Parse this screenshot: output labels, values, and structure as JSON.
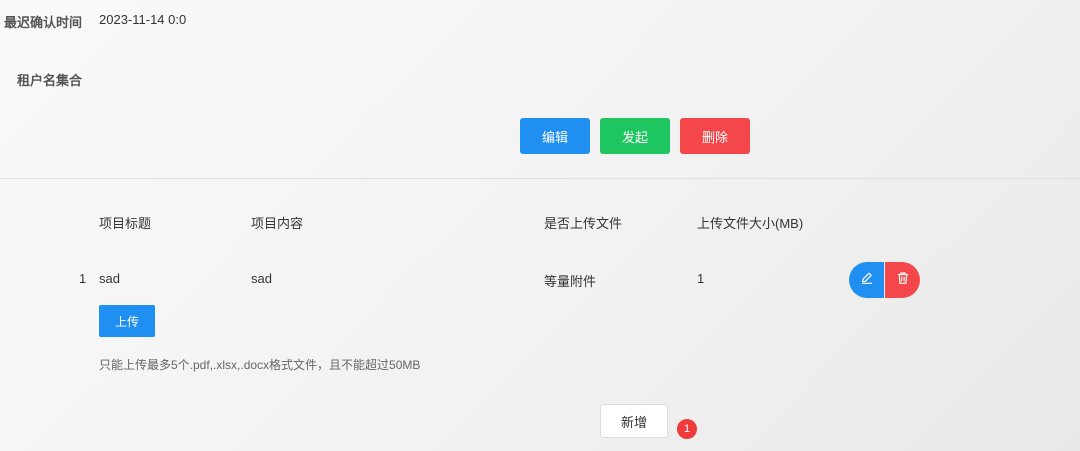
{
  "form": {
    "confirm_time_label": "最迟确认时间",
    "confirm_time_value": "2023-11-14 0:0",
    "tenant_set_label": "租户名集合"
  },
  "actions": {
    "edit_label": "编辑",
    "launch_label": "发起",
    "delete_label": "删除"
  },
  "table": {
    "headers": [
      "项目标题",
      "项目内容",
      "是否上传文件",
      "上传文件大小(MB)"
    ],
    "rows": [
      {
        "index": "1",
        "title": "sad",
        "content": "sad",
        "upload_type": "等量附件",
        "size": "1"
      }
    ],
    "row_actions": {
      "edit_icon": "pencil-icon",
      "delete_icon": "trash-icon"
    }
  },
  "upload": {
    "button_label": "上传",
    "hint": "只能上传最多5个.pdf,.xlsx,.docx格式文件，且不能超过50MB"
  },
  "add": {
    "button_label": "新增",
    "badge_count": "1"
  },
  "colors": {
    "primary": "#1f8ff2",
    "success": "#1ec660",
    "danger": "#f3474b",
    "badge": "#ef3b3b"
  }
}
